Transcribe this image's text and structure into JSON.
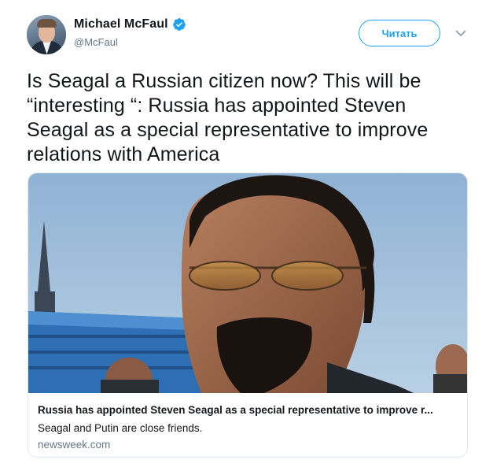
{
  "author": {
    "name": "Michael McFaul",
    "handle": "@McFaul",
    "verified": true
  },
  "follow_button": {
    "label": "Читать"
  },
  "tweet": {
    "text": "Is Seagal a Russian citizen now? This will be “interesting “: Russia has appointed Steven Seagal as a special representative to improve relations with America"
  },
  "card": {
    "title": "Russia has appointed Steven Seagal as a special representative to improve r...",
    "description": "Seagal and Putin are close friends.",
    "domain": "newsweek.com"
  },
  "colors": {
    "accent": "#1da1f2",
    "text": "#14171a",
    "muted": "#657786",
    "border": "#e1e8ed"
  },
  "icons": {
    "verified": "verified-badge-icon",
    "caret": "chevron-down-icon"
  }
}
